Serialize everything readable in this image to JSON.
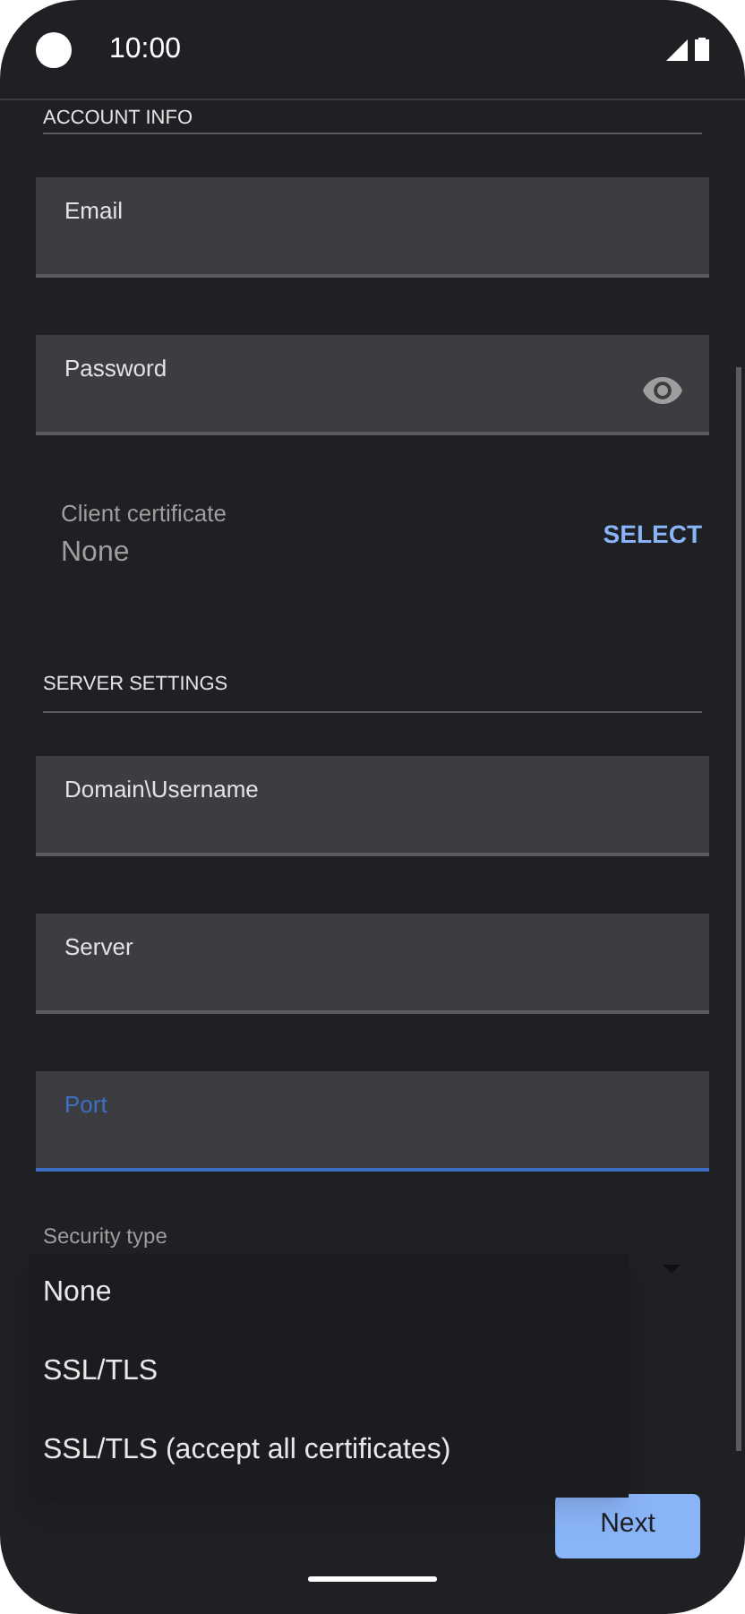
{
  "status_bar": {
    "time": "10:00"
  },
  "account_section": {
    "title": "ACCOUNT INFO"
  },
  "account_fields": [
    {
      "label": "Email",
      "visibility_toggle": false,
      "focused": false
    },
    {
      "label": "Password",
      "visibility_toggle": true,
      "focused": false
    }
  ],
  "client_certificate": {
    "label": "Client certificate",
    "value": "None",
    "action": "SELECT"
  },
  "server_section": {
    "title": "SERVER SETTINGS"
  },
  "server_fields": [
    {
      "label": "Domain\\Username",
      "visibility_toggle": false,
      "focused": false
    },
    {
      "label": "Server",
      "visibility_toggle": false,
      "focused": false
    },
    {
      "label": "Port",
      "visibility_toggle": false,
      "focused": true
    }
  ],
  "security_type": {
    "label": "Security type"
  },
  "security_menu": [
    {
      "label": "None"
    },
    {
      "label": "SSL/TLS"
    },
    {
      "label": "SSL/TLS (accept all certificates)"
    }
  ],
  "next_button": "Next"
}
